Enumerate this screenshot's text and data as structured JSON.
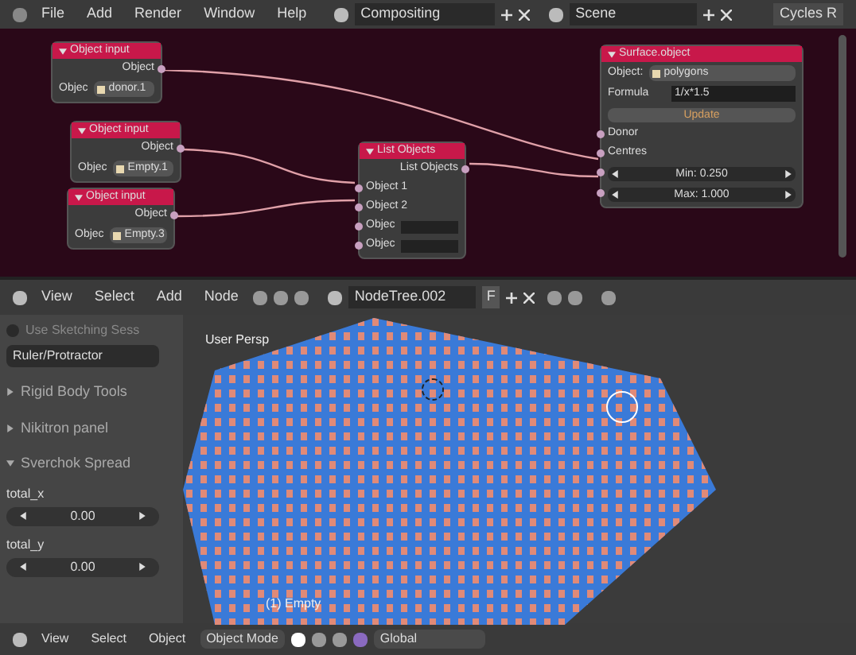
{
  "top_bar": {
    "menus": [
      "File",
      "Add",
      "Render",
      "Window",
      "Help"
    ],
    "screen": "Compositing",
    "scene": "Scene",
    "engine": "Cycles R"
  },
  "node_editor": {
    "nodes": [
      {
        "title": "Object input",
        "rows": [
          {
            "kind": "output",
            "label": "Object"
          },
          {
            "kind": "select",
            "label": "Objec",
            "value": "donor.1"
          }
        ]
      },
      {
        "title": "Object input",
        "rows": [
          {
            "kind": "output",
            "label": "Object"
          },
          {
            "kind": "select",
            "label": "Objec",
            "value": "Empty.1"
          }
        ]
      },
      {
        "title": "Object input",
        "rows": [
          {
            "kind": "output",
            "label": "Object"
          },
          {
            "kind": "select",
            "label": "Objec",
            "value": "Empty.3"
          }
        ]
      },
      {
        "title": "List Objects",
        "rows": [
          {
            "kind": "output",
            "label": "List Objects"
          },
          {
            "kind": "input",
            "label": "Object 1"
          },
          {
            "kind": "input",
            "label": "Object 2"
          },
          {
            "kind": "input_field",
            "label": "Objec"
          },
          {
            "kind": "input_field",
            "label": "Objec"
          }
        ]
      },
      {
        "title": "Surface.object",
        "rows": [
          {
            "kind": "select",
            "label": "Object:",
            "value": "polygons"
          },
          {
            "kind": "field",
            "label": "Formula",
            "value": "1/x*1.5"
          },
          {
            "kind": "button",
            "label": "Update"
          },
          {
            "kind": "input",
            "label": "Donor"
          },
          {
            "kind": "input",
            "label": "Centres"
          },
          {
            "kind": "slider",
            "label": "Min: 0.250"
          },
          {
            "kind": "slider",
            "label": "Max: 1.000"
          }
        ]
      }
    ],
    "header": {
      "menus": [
        "View",
        "Select",
        "Add",
        "Node"
      ],
      "tree": "NodeTree.002",
      "fake_user": "F"
    }
  },
  "tool_panel": {
    "sketching": {
      "label": "Use Sketching Sess",
      "checked": false
    },
    "ruler": "Ruler/Protractor",
    "panels": [
      {
        "title": "Rigid Body Tools",
        "expanded": false
      },
      {
        "title": "Nikitron panel",
        "expanded": false
      },
      {
        "title": "Sverchok Spread",
        "expanded": true,
        "fields": [
          {
            "label": "total_x",
            "value": "0.00"
          },
          {
            "label": "total_y",
            "value": "0.00"
          }
        ]
      }
    ]
  },
  "viewport": {
    "view_name": "User Persp",
    "object_label": "(1) Empty"
  },
  "bottom_bar": {
    "menus": [
      "View",
      "Select",
      "Object"
    ],
    "mode": "Object Mode",
    "orientation": "Global"
  }
}
